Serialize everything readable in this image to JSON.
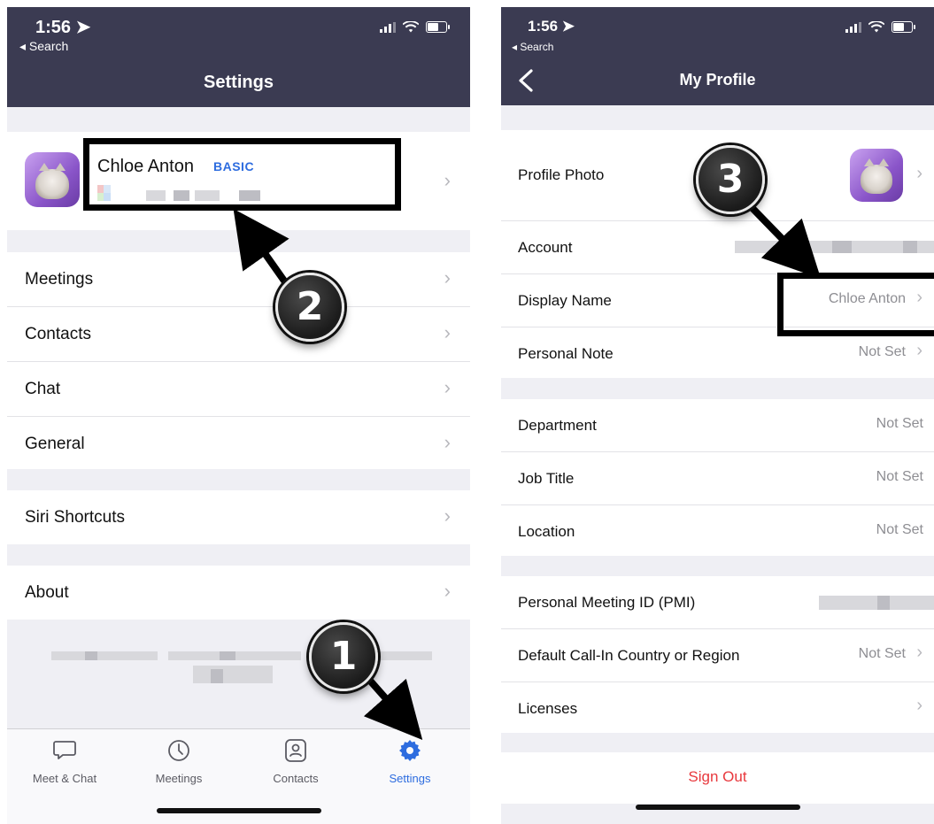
{
  "left": {
    "status": {
      "time": "1:56 ➤",
      "back": "◂ Search"
    },
    "title": "Settings",
    "profile": {
      "name": "Chloe Anton",
      "plan": "BASIC"
    },
    "menu_groups": [
      [
        "Meetings",
        "Contacts",
        "Chat",
        "General"
      ],
      [
        "Siri Shortcuts"
      ],
      [
        "About"
      ]
    ],
    "tabs": [
      {
        "label": "Meet & Chat",
        "icon": "chat-bubble-icon"
      },
      {
        "label": "Meetings",
        "icon": "clock-icon"
      },
      {
        "label": "Contacts",
        "icon": "contact-card-icon"
      },
      {
        "label": "Settings",
        "icon": "gear-icon",
        "active": true
      }
    ]
  },
  "right": {
    "status": {
      "time": "1:56 ➤",
      "back": "◂ Search"
    },
    "title": "My Profile",
    "rows": {
      "profile_photo": "Profile Photo",
      "account": "Account",
      "display_name": "Display Name",
      "display_name_value": "Chloe Anton",
      "personal_note": "Personal Note",
      "personal_note_value": "Not Set",
      "department": "Department",
      "department_value": "Not Set",
      "job_title": "Job Title",
      "job_title_value": "Not Set",
      "location": "Location",
      "location_value": "Not Set",
      "pmi": "Personal Meeting ID (PMI)",
      "call_in": "Default Call-In Country or Region",
      "call_in_value": "Not Set",
      "licenses": "Licenses"
    },
    "sign_out": "Sign Out"
  },
  "annotations": {
    "step1": "1",
    "step2": "2",
    "step3": "3"
  },
  "colors": {
    "header": "#3b3b52",
    "accent": "#2d6cdf",
    "danger": "#e8383d",
    "background": "#efeff4"
  }
}
